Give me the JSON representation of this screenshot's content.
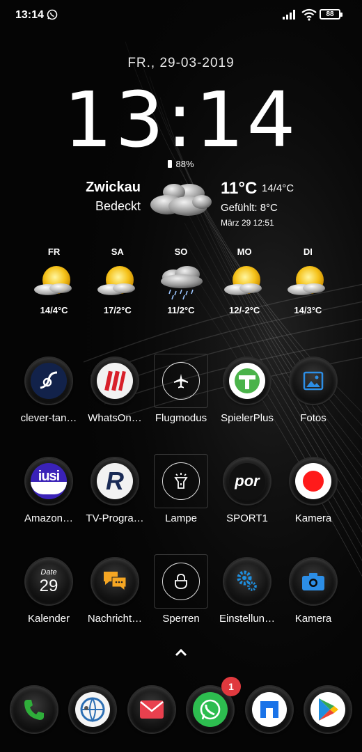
{
  "status_bar": {
    "time": "13:14",
    "notification_icon": "whatsapp-icon",
    "battery_level": "88"
  },
  "lockclock": {
    "date": "FR., 29-03-2019",
    "time": "13:14",
    "battery": "88%"
  },
  "weather": {
    "city": "Zwickau",
    "condition": "Bedeckt",
    "temperature": "11°C",
    "range": "14/4°C",
    "feels_like": "Gefühlt: 8°C",
    "updated": "März 29  12:51",
    "forecast": [
      {
        "day": "FR",
        "icon": "sun-cloud-icon",
        "temp": "14/4°C"
      },
      {
        "day": "SA",
        "icon": "sun-cloud-icon",
        "temp": "17/2°C"
      },
      {
        "day": "SO",
        "icon": "rain-cloud-icon",
        "temp": "11/2°C"
      },
      {
        "day": "MO",
        "icon": "sun-cloud-icon",
        "temp": "12/-2°C"
      },
      {
        "day": "DI",
        "icon": "sun-cloud-icon",
        "temp": "14/3°C"
      }
    ]
  },
  "apps": [
    {
      "label": "clever-tan…",
      "icon": "clever-tanken-icon"
    },
    {
      "label": "WhatsOn…",
      "icon": "whatson-icon"
    },
    {
      "label": "Flugmodus",
      "icon": "airplane-icon"
    },
    {
      "label": "SpielerPlus",
      "icon": "spielerplus-icon"
    },
    {
      "label": "Fotos",
      "icon": "photos-icon"
    },
    {
      "label": "Amazon…",
      "icon": "amazon-music-icon",
      "icon_text": "iusi"
    },
    {
      "label": "TV-Progra…",
      "icon": "tv-program-icon",
      "icon_text": "R"
    },
    {
      "label": "Lampe",
      "icon": "flashlight-icon"
    },
    {
      "label": "SPORT1",
      "icon": "sport1-icon",
      "icon_text": "por"
    },
    {
      "label": "Kamera",
      "icon": "record-icon"
    },
    {
      "label": "Kalender",
      "icon": "calendar-icon",
      "icon_text": "Date",
      "icon_number": "29"
    },
    {
      "label": "Nachricht…",
      "icon": "messages-icon"
    },
    {
      "label": "Sperren",
      "icon": "lock-icon"
    },
    {
      "label": "Einstellun…",
      "icon": "settings-icon"
    },
    {
      "label": "Kamera",
      "icon": "camera-icon"
    }
  ],
  "dock": [
    {
      "icon": "phone-icon"
    },
    {
      "icon": "browser-icon"
    },
    {
      "icon": "mail-icon"
    },
    {
      "icon": "whatsapp-icon",
      "badge": "1"
    },
    {
      "icon": "files-icon"
    },
    {
      "icon": "play-store-icon"
    }
  ],
  "colors": {
    "background": "#050505",
    "badge": "#e0393e",
    "phone_green": "#2fae3a",
    "whatsapp_green": "#2dbd4f",
    "mail_red": "#e8404e",
    "spielerplus_green": "#4ab34a",
    "camera_red": "#ff1a1a",
    "settings_blue": "#1e8fe0",
    "messages_orange": "#f5a623"
  }
}
